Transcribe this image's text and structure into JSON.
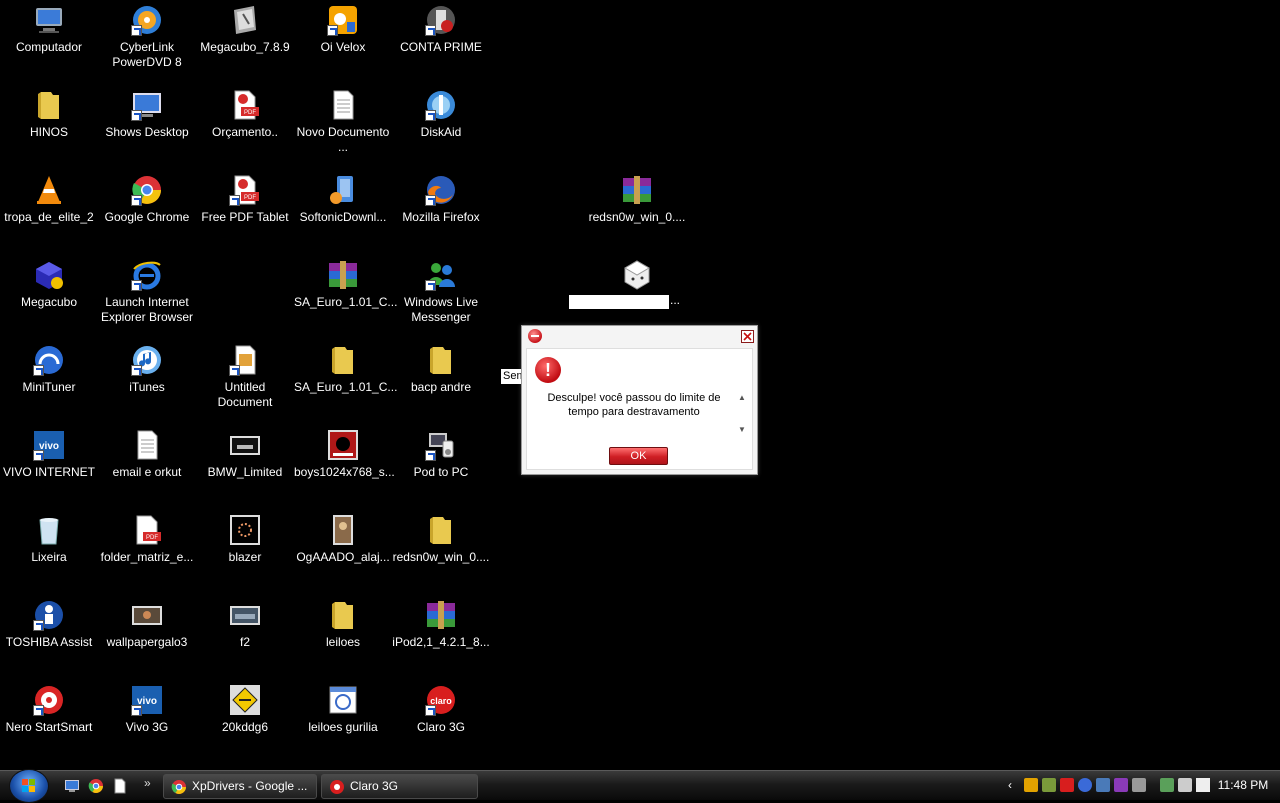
{
  "desktop": {
    "icons": [
      {
        "label": "Computador",
        "icon": "computer-icon"
      },
      {
        "label": "CyberLink PowerDVD 8",
        "icon": "powerdvd-icon"
      },
      {
        "label": "Megacubo_7.8.9",
        "icon": "installer-icon"
      },
      {
        "label": "Oi Velox",
        "icon": "oi-velox-icon"
      },
      {
        "label": "CONTA PRIME",
        "icon": "conta-prime-icon"
      },
      {
        "label": "HINOS",
        "icon": "folder-icon"
      },
      {
        "label": "Shows Desktop",
        "icon": "show-desktop-icon"
      },
      {
        "label": "Orçamento..",
        "icon": "pdf-icon"
      },
      {
        "label": "Novo Documento ...",
        "icon": "text-document-icon"
      },
      {
        "label": "DiskAid",
        "icon": "diskaid-icon"
      },
      {
        "label": "tropa_de_elite_2",
        "icon": "vlc-icon"
      },
      {
        "label": "Google Chrome",
        "icon": "chrome-icon"
      },
      {
        "label": "Free PDF Tablet",
        "icon": "pdf-icon"
      },
      {
        "label": "SoftonicDownl...",
        "icon": "softonic-icon"
      },
      {
        "label": "Mozilla Firefox",
        "icon": "firefox-icon"
      },
      {
        "label": "redsn0w_win_0....",
        "icon": "winrar-icon"
      },
      {
        "label": "Megacubo",
        "icon": "megacubo-icon"
      },
      {
        "label": "Launch Internet Explorer Browser",
        "icon": "ie-icon"
      },
      {
        "label": "SA_Euro_1.01_C...",
        "icon": "winrar-icon"
      },
      {
        "label": "Windows Live Messenger",
        "icon": "messenger-icon"
      },
      {
        "label": "...",
        "icon": "cube-icon"
      },
      {
        "label": "MiniTuner",
        "icon": "minituner-icon"
      },
      {
        "label": "iTunes",
        "icon": "itunes-icon"
      },
      {
        "label": "Untitled Document",
        "icon": "document-icon"
      },
      {
        "label": "SA_Euro_1.01_C...",
        "icon": "folder-icon"
      },
      {
        "label": "bacp andre",
        "icon": "folder-icon"
      },
      {
        "label": "VIVO INTERNET",
        "icon": "vivo-icon"
      },
      {
        "label": "email e orkut",
        "icon": "text-document-icon"
      },
      {
        "label": "BMW_Limited",
        "icon": "image-icon"
      },
      {
        "label": "boys1024x768_s...",
        "icon": "image-icon"
      },
      {
        "label": "Pod to PC",
        "icon": "pod-to-pc-icon"
      },
      {
        "label": "Lixeira",
        "icon": "recycle-bin-icon"
      },
      {
        "label": "folder_matriz_e...",
        "icon": "pdf-icon"
      },
      {
        "label": "blazer",
        "icon": "image-icon"
      },
      {
        "label": "OgAAADO_alaj...",
        "icon": "image-icon"
      },
      {
        "label": "redsn0w_win_0....",
        "icon": "folder-icon"
      },
      {
        "label": "TOSHIBA Assist",
        "icon": "toshiba-assist-icon"
      },
      {
        "label": "wallpapergalo3",
        "icon": "image-icon"
      },
      {
        "label": "f2",
        "icon": "image-icon"
      },
      {
        "label": "leiloes",
        "icon": "folder-icon"
      },
      {
        "label": "iPod2,1_4.2.1_8...",
        "icon": "winrar-icon"
      },
      {
        "label": "Nero StartSmart",
        "icon": "nero-icon"
      },
      {
        "label": "Vivo 3G",
        "icon": "vivo-icon"
      },
      {
        "label": "20kddg6",
        "icon": "image-icon"
      },
      {
        "label": "leiloes gurilia",
        "icon": "web-page-icon"
      },
      {
        "label": "Claro 3G",
        "icon": "claro-icon"
      }
    ],
    "fragment_text": "Sem"
  },
  "dialog": {
    "message": "Desculpe! você passou do limite de tempo para destravamento",
    "ok_label": "OK",
    "accent": "#c8141a"
  },
  "taskbar": {
    "tasks": [
      {
        "label": "XpDrivers - Google ...",
        "icon": "chrome-icon"
      },
      {
        "label": "Claro 3G",
        "icon": "claro-icon"
      }
    ],
    "quick_launch": [
      "show-desktop-icon",
      "chrome-icon",
      "document-icon"
    ],
    "clock": "11:48 PM"
  }
}
